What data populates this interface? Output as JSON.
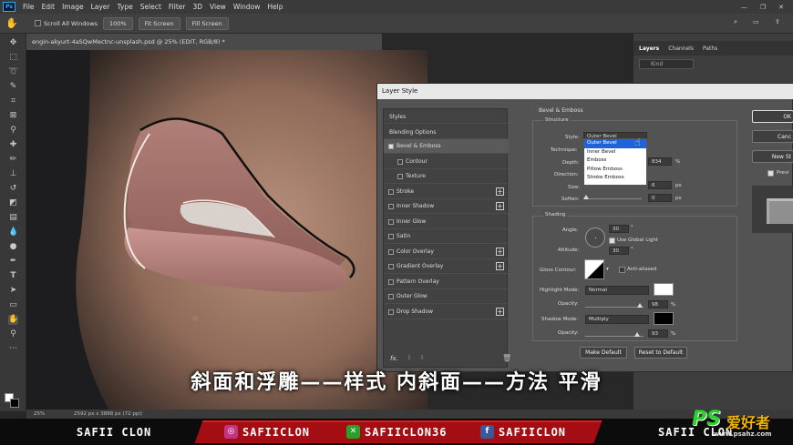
{
  "menubar": {
    "logo": "Ps",
    "items": [
      "File",
      "Edit",
      "Image",
      "Layer",
      "Type",
      "Select",
      "Filter",
      "3D",
      "View",
      "Window",
      "Help"
    ]
  },
  "options": {
    "scroll_all": "Scroll All Windows",
    "zoom_btn": "100%",
    "fit_btn": "Fit Screen",
    "fill_btn": "Fill Screen"
  },
  "document": {
    "tab_title": "engin-akyurt-4aSQwMectnc-unsplash.psd @ 25% (EDIT, RGB/8) *",
    "zoom": "25%",
    "size": "2592 px x 3888 px (72 ppi)"
  },
  "panel": {
    "tabs": [
      "Layers",
      "Channels",
      "Paths"
    ],
    "kind": "Kind"
  },
  "dialog": {
    "title": "Layer Style",
    "styles": [
      {
        "label": "Styles",
        "sub": false,
        "cb": null,
        "plus": false
      },
      {
        "label": "Blending Options",
        "sub": false,
        "cb": null,
        "plus": false
      },
      {
        "label": "Bevel & Emboss",
        "sub": false,
        "cb": true,
        "plus": false,
        "selected": true
      },
      {
        "label": "Contour",
        "sub": true,
        "cb": false,
        "plus": false
      },
      {
        "label": "Texture",
        "sub": true,
        "cb": false,
        "plus": false
      },
      {
        "label": "Stroke",
        "sub": false,
        "cb": false,
        "plus": true
      },
      {
        "label": "Inner Shadow",
        "sub": false,
        "cb": false,
        "plus": true
      },
      {
        "label": "Inner Glow",
        "sub": false,
        "cb": false,
        "plus": false
      },
      {
        "label": "Satin",
        "sub": false,
        "cb": false,
        "plus": false
      },
      {
        "label": "Color Overlay",
        "sub": false,
        "cb": false,
        "plus": true
      },
      {
        "label": "Gradient Overlay",
        "sub": false,
        "cb": false,
        "plus": true
      },
      {
        "label": "Pattern Overlay",
        "sub": false,
        "cb": false,
        "plus": false
      },
      {
        "label": "Outer Glow",
        "sub": false,
        "cb": false,
        "plus": false
      },
      {
        "label": "Drop Shadow",
        "sub": false,
        "cb": false,
        "plus": true
      }
    ],
    "fx": "fx.",
    "section_title": "Bevel & Emboss",
    "structure": {
      "title": "Structure",
      "style_label": "Style:",
      "style_value": "Outer Bevel",
      "technique_label": "Technique:",
      "depth_label": "Depth:",
      "depth_value": "834",
      "depth_unit": "%",
      "direction_label": "Direction:",
      "size_label": "Size:",
      "size_value": "6",
      "size_unit": "px",
      "soften_label": "Soften:",
      "soften_value": "0",
      "soften_unit": "px"
    },
    "dropdown_options": [
      "Outer Bevel",
      "Inner Bevel",
      "Emboss",
      "Pillow Emboss",
      "Stroke Emboss"
    ],
    "shading": {
      "title": "Shading",
      "angle_label": "Angle:",
      "angle_value": "30",
      "global_light": "Use Global Light",
      "altitude_label": "Altitude:",
      "altitude_value": "30",
      "gloss_label": "Gloss Contour:",
      "anti_aliased": "Anti-aliased",
      "highlight_label": "Highlight Mode:",
      "highlight_value": "Normal",
      "highlight_color": "#ffffff",
      "opacity_label": "Opacity:",
      "h_opacity": "98",
      "shadow_label": "Shadow Mode:",
      "shadow_value": "Multiply",
      "shadow_color": "#000000",
      "s_opacity": "93",
      "pct": "%"
    },
    "make_default": "Make Default",
    "reset_default": "Reset to Default",
    "ok": "OK",
    "cancel": "Canc",
    "new_style": "New St",
    "preview": "Previ"
  },
  "subtitle": "斜面和浮雕——样式 内斜面——方法 平滑",
  "banner": {
    "left_name": "SAFII CLON",
    "instagram": "SAFIICLON",
    "xbox": "SAFIICLON36",
    "facebook": "SAFIICLON",
    "right_name": "SAFII CLON",
    "accent": "#a40d12"
  },
  "watermark": {
    "ps": "PS",
    "cn": "爱好者",
    "url": "www.psahz.com"
  }
}
